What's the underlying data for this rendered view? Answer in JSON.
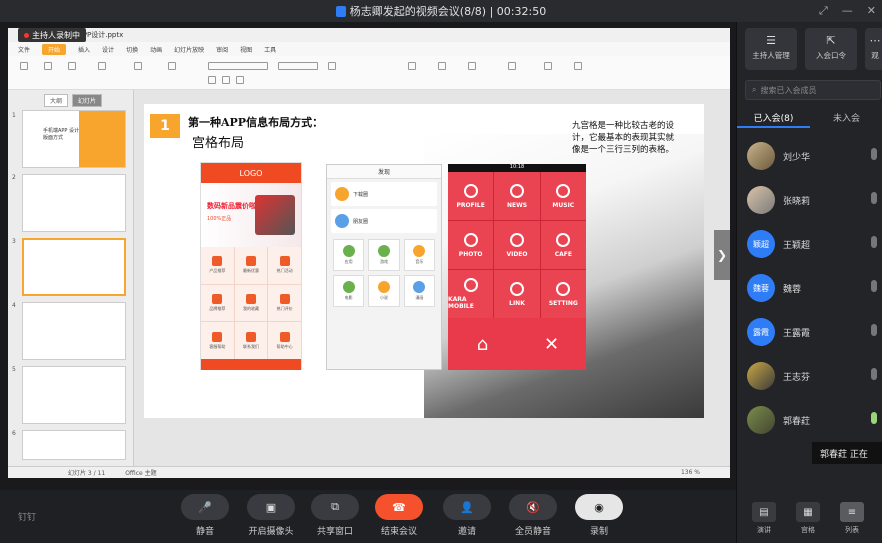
{
  "window": {
    "title": "杨志卿发起的视频会议(8/8)",
    "timer": "00:32:50"
  },
  "recording": {
    "label": "主持人录制中"
  },
  "ppt": {
    "file_title": "APP设计.pptx",
    "menu": [
      "文件",
      "开始",
      "插入",
      "设计",
      "切换",
      "动画",
      "幻灯片放映",
      "审阅",
      "视图",
      "工具"
    ],
    "thumb_tabs": [
      "大纲",
      "幻灯片"
    ],
    "thumb_numbers": [
      "1",
      "2",
      "3",
      "4",
      "5",
      "6"
    ],
    "thumb1_text": "手机端APP 设计版面方式",
    "status": {
      "slide": "幻灯片 3 / 11",
      "theme": "Office 主题",
      "zoom": "136 %"
    }
  },
  "slide": {
    "number": "1",
    "title": "第一种APP信息布局方式：",
    "subtitle": "宫格布局",
    "description": "九宫格是一种比较古老的设计，它最基本的表现其实就像是一个三行三列的表格。",
    "phone1": {
      "logo": "LOGO",
      "banner_line1": "数码新品震价啦!",
      "banner_line2": "100%正品",
      "items": [
        "产品推荐",
        "最新优惠",
        "热门活动",
        "品牌推荐",
        "我的收藏",
        "热门评价",
        "客服帮助",
        "联系我们",
        "帮助中心"
      ]
    },
    "phone2": {
      "header": "发现",
      "rows": [
        "下载圈",
        "朋友圈"
      ],
      "items": [
        "应用",
        "游戏",
        "音乐",
        "电影",
        "小说",
        "漫画"
      ]
    },
    "phone3": {
      "status": "10:18",
      "tiles": [
        "PROFILE",
        "NEWS",
        "MUSIC",
        "PHOTO",
        "VIDEO",
        "CAFE",
        "KARA MOBILE",
        "LINK",
        "SETTING"
      ],
      "home": "⌂",
      "close": "✕"
    }
  },
  "controls": [
    {
      "label": "静音",
      "icon": "🎤"
    },
    {
      "label": "开启摄像头",
      "icon": "▣"
    },
    {
      "label": "共享窗口",
      "icon": "⧉"
    },
    {
      "label": "结束会议",
      "icon": "☎"
    },
    {
      "label": "邀请",
      "icon": "👤"
    },
    {
      "label": "全员静音",
      "icon": "🔇"
    },
    {
      "label": "录制",
      "icon": "◉"
    }
  ],
  "footer_brand": "钉钉",
  "sidebar": {
    "top_buttons": [
      {
        "label": "主持人管理",
        "icon": "☰"
      },
      {
        "label": "入会口令",
        "icon": "⇱"
      },
      {
        "label": "观",
        "icon": "⋯"
      }
    ],
    "search_placeholder": "搜索已入会成员",
    "tabs": [
      "已入会(8)",
      "未入会"
    ],
    "participants": [
      {
        "name": "刘少华",
        "avatar": "",
        "style": "photo"
      },
      {
        "name": "张晓莉",
        "avatar": "",
        "style": "photo2"
      },
      {
        "name": "王颖超",
        "avatar": "颖超",
        "style": "blue"
      },
      {
        "name": "魏蓉",
        "avatar": "魏蓉",
        "style": "blue"
      },
      {
        "name": "王露霞",
        "avatar": "露霞",
        "style": "blue"
      },
      {
        "name": "王志芬",
        "avatar": "",
        "style": "photo3"
      },
      {
        "name": "郭春荭",
        "avatar": "",
        "style": "photo4"
      }
    ],
    "speaking_tooltip": "郭春荭 正在",
    "bottom_tabs": [
      {
        "label": "演讲",
        "icon": "▤"
      },
      {
        "label": "宫格",
        "icon": "▦"
      },
      {
        "label": "列表",
        "icon": "≡"
      }
    ]
  }
}
